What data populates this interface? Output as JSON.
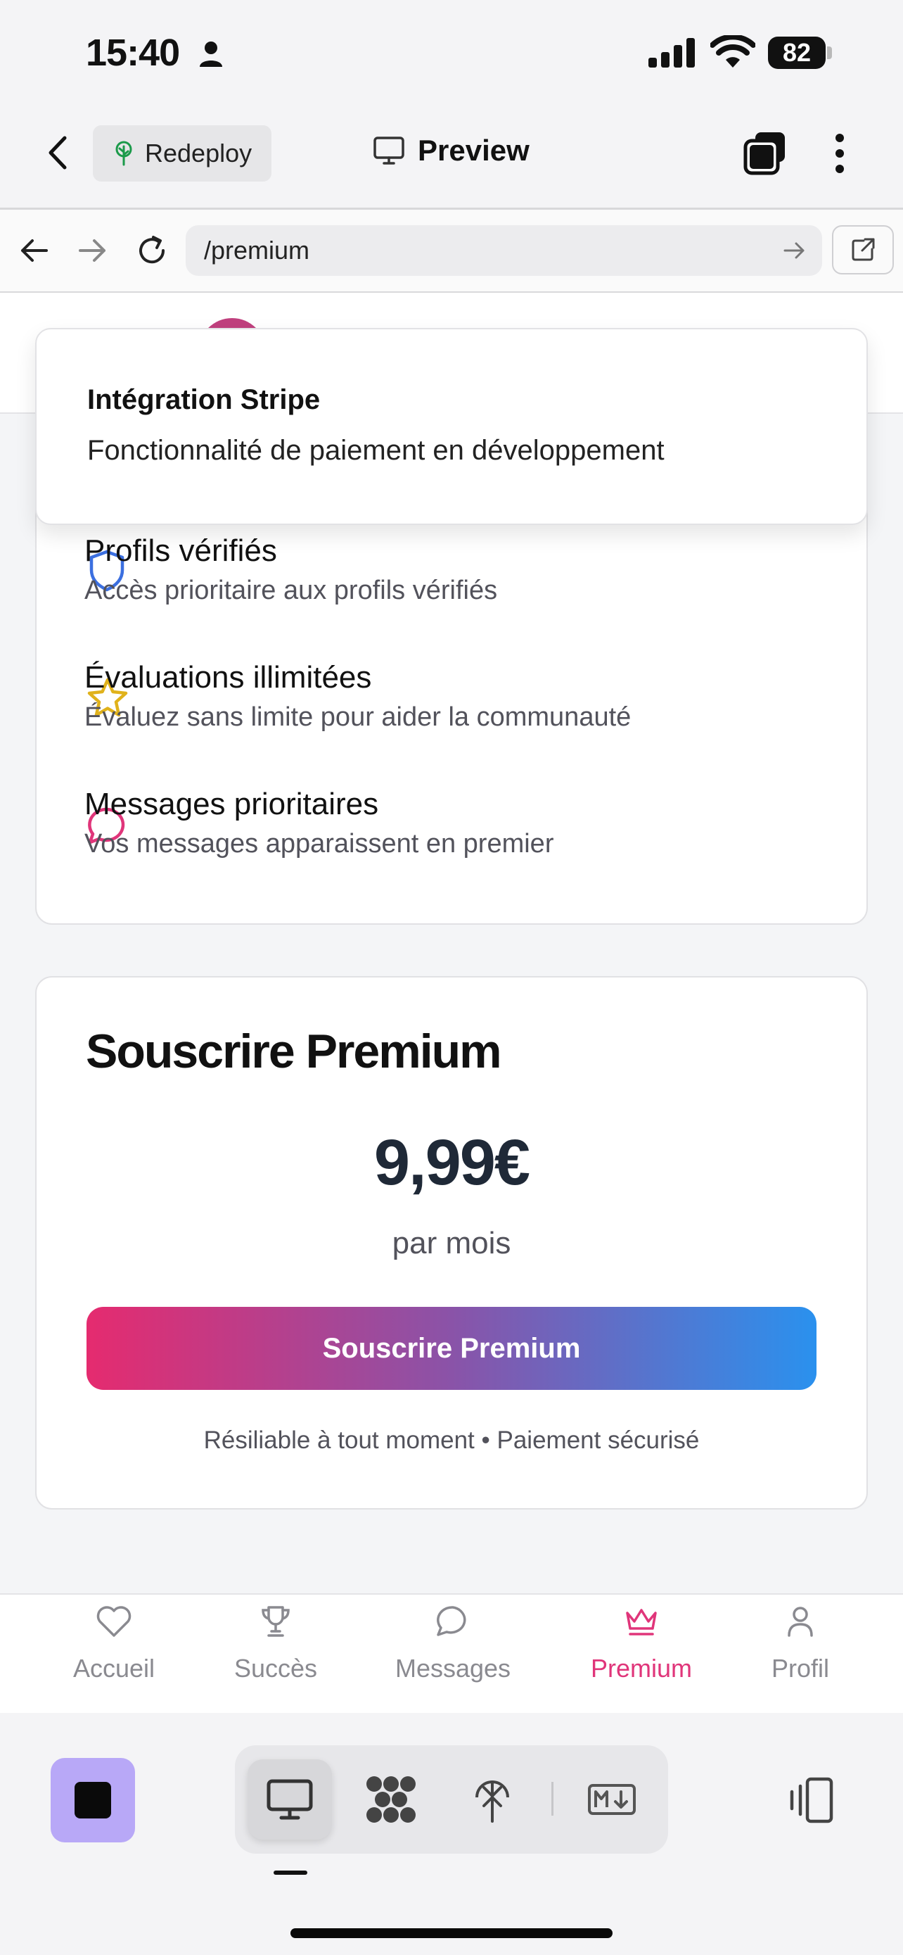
{
  "status_bar": {
    "time": "15:40",
    "battery": "82"
  },
  "app_toolbar": {
    "redeploy_label": "Redeploy",
    "preview_label": "Preview"
  },
  "browser": {
    "url": "/premium"
  },
  "features": [
    {
      "title": "Profils vérifiés",
      "description": "Accès prioritaire aux profils vérifiés",
      "icon": "shield-icon",
      "color": "#3b6fe0"
    },
    {
      "title": "Évaluations illimitées",
      "description": "Évaluez sans limite pour aider la communauté",
      "icon": "star-icon",
      "color": "#e0b21b"
    },
    {
      "title": "Messages prioritaires",
      "description": "Vos messages apparaissent en premier",
      "icon": "message-icon",
      "color": "#e0357a"
    }
  ],
  "subscription": {
    "title": "Souscrire Premium",
    "price": "9,99€",
    "period": "par mois",
    "button_label": "Souscrire Premium",
    "note": "Résiliable à tout moment • Paiement sécurisé"
  },
  "toast": {
    "title": "Intégration Stripe",
    "description": "Fonctionnalité de paiement en développement"
  },
  "tabs": [
    {
      "label": "Accueil",
      "icon": "heart-icon",
      "active": false
    },
    {
      "label": "Succès",
      "icon": "trophy-icon",
      "active": false
    },
    {
      "label": "Messages",
      "icon": "message-icon",
      "active": false
    },
    {
      "label": "Premium",
      "icon": "crown-icon",
      "active": true
    },
    {
      "label": "Profil",
      "icon": "user-icon",
      "active": false
    }
  ],
  "colors": {
    "accent": "#e0357a",
    "gradient_start": "#e52b6f",
    "gradient_end": "#2a91ee"
  }
}
